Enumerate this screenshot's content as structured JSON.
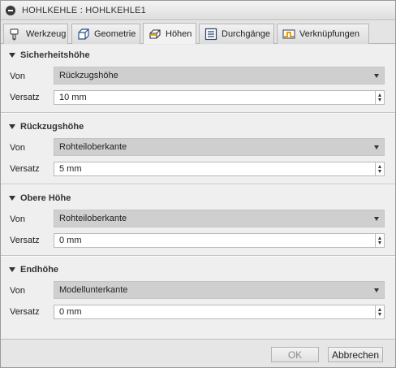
{
  "window": {
    "title": "HOHLKEHLE : HOHLKEHLE1",
    "title_icon": "minus-circle-icon"
  },
  "tabs": [
    {
      "label": "Werkzeug",
      "icon": "tool-icon",
      "active": false
    },
    {
      "label": "Geometrie",
      "icon": "cube-icon",
      "active": false
    },
    {
      "label": "Höhen",
      "icon": "heights-icon",
      "active": true
    },
    {
      "label": "Durchgänge",
      "icon": "passes-icon",
      "active": false
    },
    {
      "label": "Verknüpfungen",
      "icon": "linking-icon",
      "active": false
    }
  ],
  "sections": [
    {
      "title": "Sicherheitshöhe",
      "von_label": "Von",
      "von_value": "Rückzugshöhe",
      "versatz_label": "Versatz",
      "versatz_value": "10 mm"
    },
    {
      "title": "Rückzugshöhe",
      "von_label": "Von",
      "von_value": "Rohteiloberkante",
      "versatz_label": "Versatz",
      "versatz_value": "5 mm"
    },
    {
      "title": "Obere Höhe",
      "von_label": "Von",
      "von_value": "Rohteiloberkante",
      "versatz_label": "Versatz",
      "versatz_value": "0 mm"
    },
    {
      "title": "Endhöhe",
      "von_label": "Von",
      "von_value": "Modellunterkante",
      "versatz_label": "Versatz",
      "versatz_value": "0 mm"
    }
  ],
  "footer": {
    "ok_label": "OK",
    "cancel_label": "Abbrechen"
  },
  "colors": {
    "select_bg": "#cfcfcf",
    "panel_bg": "#efefef",
    "ok_disabled_text": "#8a8a8a"
  }
}
